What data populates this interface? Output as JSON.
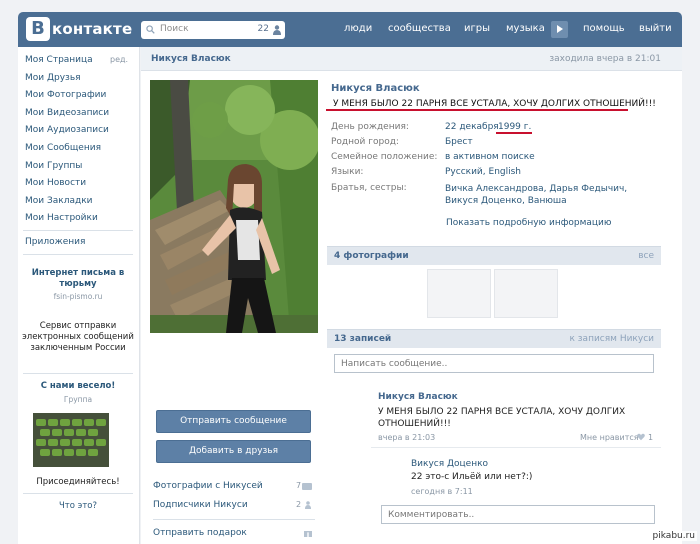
{
  "header": {
    "logo_letter": "В",
    "logo_text": "контакте",
    "search_placeholder": "Поиск",
    "search_count": "22",
    "nav": [
      "люди",
      "сообщества",
      "игры",
      "музыка",
      "помощь",
      "выйти"
    ]
  },
  "left_menu": {
    "items": [
      "Моя Страница",
      "Мои Друзья",
      "Мои Фотографии",
      "Мои Видеозаписи",
      "Мои Аудиозаписи",
      "Мои Сообщения",
      "Мои Группы",
      "Мои Новости",
      "Мои Закладки",
      "Мои Настройки"
    ],
    "edit": "ред.",
    "apps": "Приложения",
    "ad1_title": "Интернет письма в тюрьму",
    "ad1_sub": "fsin-pismo.ru",
    "ad2_text": "Сервис отправки электронных сообщений заключенным России",
    "ad3_title": "С нами весело!",
    "ad3_sub": "Группа",
    "ad3_join": "Присоединяйтесь!",
    "what": "Что это?"
  },
  "profile": {
    "bar_name": "Никуся Власюк",
    "bar_status": "заходила вчера в 21:01",
    "name": "Никуся Власюк",
    "status": "У МЕНЯ БЫЛО 22 ПАРНЯ ВСЕ УСТАЛА, ХОЧУ ДОЛГИХ ОТНОШЕНИЙ!!!",
    "labels": {
      "birthday": "День рождения:",
      "hometown": "Родной город:",
      "family": "Семейное положение:",
      "languages": "Языки:",
      "siblings": "Братья, сестры:"
    },
    "birthday_day": "22 декабря",
    "birthday_year": "1999 г.",
    "hometown": "Брест",
    "family": "в активном поиске",
    "languages": "Русский, English",
    "siblings": "Вичка Александрова, Дарья Федычич, Викуся Доценко, Ванюша",
    "more_info": "Показать подробную информацию",
    "photos_title": "4 фотографии",
    "photos_all": "все",
    "wall_title": "13 записей",
    "wall_link": "к записям Никуси",
    "wall_placeholder": "Написать сообщение.."
  },
  "actions": {
    "send_message": "Отправить сообщение",
    "add_friend": "Добавить в друзья",
    "photos_with": "Фотографии с Никусей",
    "photos_with_count": "7",
    "subscribers": "Подписчики Никуси",
    "subscribers_count": "2",
    "send_gift": "Отправить подарок"
  },
  "post": {
    "author": "Никуся Власюк",
    "text": "У МЕНЯ БЫЛО 22 ПАРНЯ ВСЕ УСТАЛА, ХОЧУ ДОЛГИХ ОТНОШЕНИЙ!!!",
    "time": "вчера в 21:03",
    "like": "Мне нравится",
    "like_count": "1",
    "comment_author": "Викуся Доценко",
    "comment_text": "22 это-с Ильёй или нет?:)",
    "comment_time": "сегодня в 7:11",
    "comment_placeholder": "Комментировать.."
  },
  "watermark": "pikabu.ru",
  "colors": {
    "header": "#4b6e93",
    "link": "#2b587a",
    "button": "#5d80a6",
    "underline": "#c8102e"
  }
}
